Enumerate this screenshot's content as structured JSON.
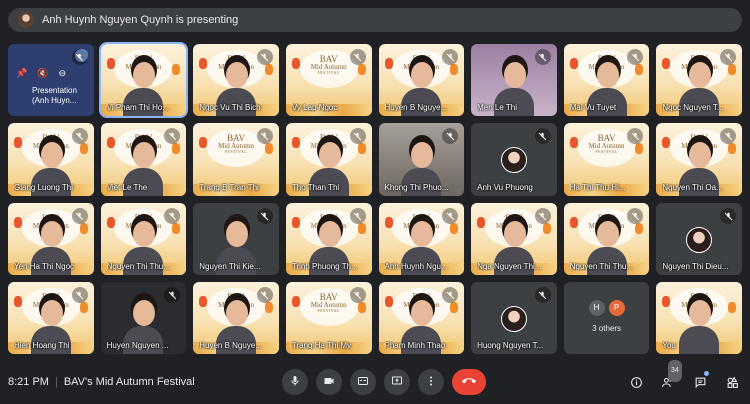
{
  "presenting_banner": "Anh Huynh Nguyen Quynh is presenting",
  "tiles": [
    {
      "name": "Presentation (Anh Huyn...",
      "kind": "presentation",
      "mic": "off"
    },
    {
      "name": "Vi Pham Thi Ho...",
      "kind": "person-fest",
      "mic": "",
      "active": true
    },
    {
      "name": "Ngoc Vu Thi Bich",
      "kind": "person-fest",
      "mic": "off"
    },
    {
      "name": "Vy Lap Ngoc",
      "kind": "fest",
      "mic": "off"
    },
    {
      "name": "Huyen B Nguye...",
      "kind": "person-fest",
      "mic": "off"
    },
    {
      "name": "Men Le Thi",
      "kind": "person-purple",
      "mic": "off"
    },
    {
      "name": "Mai Vu Tuyet",
      "kind": "person-fest",
      "mic": "off"
    },
    {
      "name": "Ngoc Nguyen T...",
      "kind": "person-fest",
      "mic": "off"
    },
    {
      "name": "Giang Luong Thi",
      "kind": "person-fest",
      "mic": "off"
    },
    {
      "name": "Viet Le The",
      "kind": "person-fest",
      "mic": "off"
    },
    {
      "name": "Trang B Tran Thi",
      "kind": "fest",
      "mic": "off"
    },
    {
      "name": "Tho Than Thi",
      "kind": "person-fest",
      "mic": "off"
    },
    {
      "name": "Khong Thi Phuo...",
      "kind": "person-room",
      "mic": "off"
    },
    {
      "name": "Anh Vu Phuong",
      "kind": "avatar",
      "mic": "off"
    },
    {
      "name": "Ha Thi Thu Hi...",
      "kind": "fest",
      "mic": "off"
    },
    {
      "name": "Nguyen Thi Oa...",
      "kind": "person-fest",
      "mic": "off"
    },
    {
      "name": "Yen Ha Thi Ngoc",
      "kind": "person-fest",
      "mic": "off"
    },
    {
      "name": "Nguyen Thi Thu...",
      "kind": "person-fest",
      "mic": "off"
    },
    {
      "name": "Nguyen Thi Kie...",
      "kind": "person-dark",
      "mic": "off"
    },
    {
      "name": "Trinh Phuong Th...",
      "kind": "person-fest",
      "mic": "off"
    },
    {
      "name": "Anh Huynh Ngu...",
      "kind": "person-fest",
      "mic": "off"
    },
    {
      "name": "Nga Nguyen Thi...",
      "kind": "person-fest",
      "mic": "off"
    },
    {
      "name": "Nguyen Thi Thu...",
      "kind": "person-fest",
      "mic": "off"
    },
    {
      "name": "Nguyen Thi Dieu...",
      "kind": "avatar",
      "mic": "off"
    },
    {
      "name": "Hien Hoang Thi",
      "kind": "person-fest",
      "mic": "off"
    },
    {
      "name": "Huyen Nguyen ...",
      "kind": "person-dark2",
      "mic": "off"
    },
    {
      "name": "Huyen B Nguye...",
      "kind": "person-fest",
      "mic": "off"
    },
    {
      "name": "Trang Ha Thi My",
      "kind": "fest",
      "mic": "off"
    },
    {
      "name": "Pham Minh Thao",
      "kind": "person-fest",
      "mic": "off"
    },
    {
      "name": "Huong Nguyen T...",
      "kind": "avatar",
      "mic": "off"
    },
    {
      "name": "3 others",
      "kind": "others",
      "mic": "",
      "initials": [
        "H",
        "P"
      ]
    },
    {
      "name": "You",
      "kind": "person-fest",
      "mic": ""
    }
  ],
  "banner_text": {
    "line1": "BAV",
    "line2": "Mid Autumn",
    "line3": "FESTIVAL"
  },
  "bottom": {
    "time": "8:21 PM",
    "separator": "|",
    "meeting_title": "BAV's Mid Autumn Festival",
    "people_count": "34"
  },
  "icons": {
    "mic": "mic-icon",
    "camera": "camera-icon",
    "captions": "captions-icon",
    "present": "present-icon",
    "more": "more-icon",
    "end": "end-call-icon",
    "info": "info-icon",
    "people": "people-icon",
    "chat": "chat-icon",
    "activities": "activities-icon"
  },
  "colors": {
    "end_call": "#ea4335",
    "accent": "#8ab4f8",
    "background": "#202124",
    "tile": "#3c4043"
  }
}
